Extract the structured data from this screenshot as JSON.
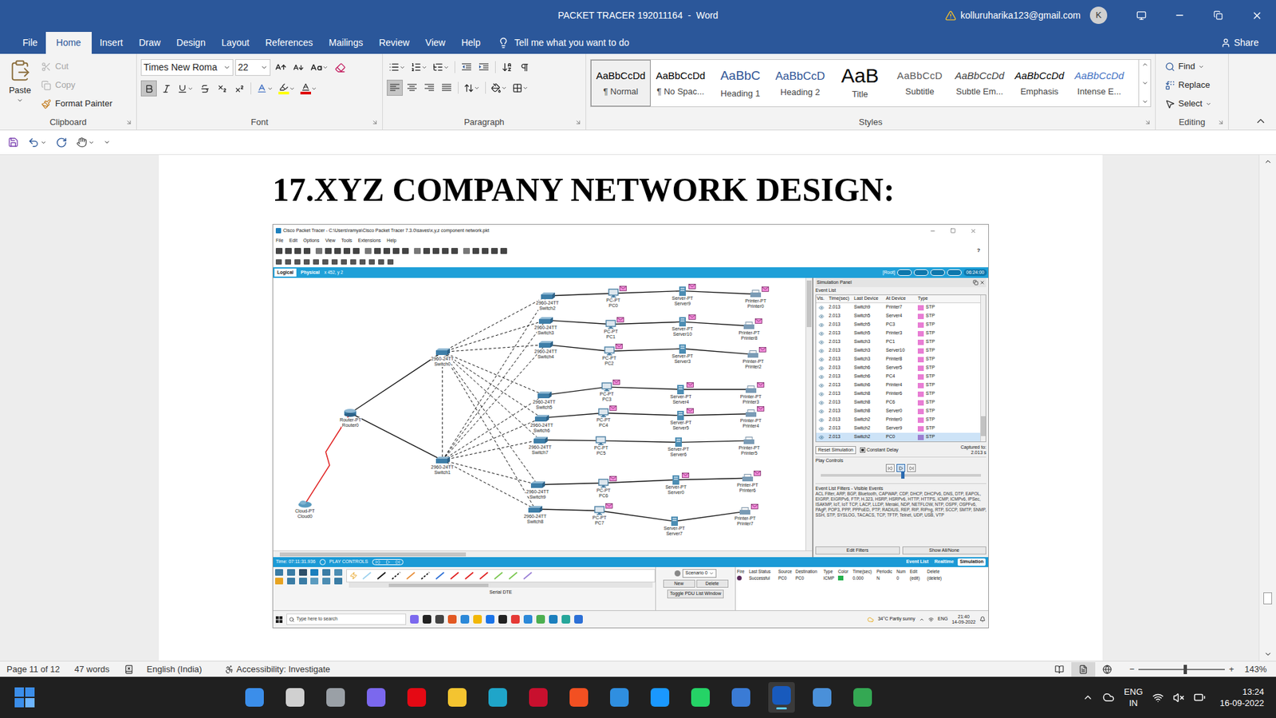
{
  "word": {
    "title": "PACKET TRACER 192011164  -  Word",
    "account": "kolluruharika123@gmail.com",
    "avatar": "K",
    "tabs": [
      {
        "label": "File",
        "selected": false
      },
      {
        "label": "Home",
        "selected": true
      },
      {
        "label": "Insert",
        "selected": false
      },
      {
        "label": "Draw",
        "selected": false
      },
      {
        "label": "Design",
        "selected": false
      },
      {
        "label": "Layout",
        "selected": false
      },
      {
        "label": "References",
        "selected": false
      },
      {
        "label": "Mailings",
        "selected": false
      },
      {
        "label": "Review",
        "selected": false
      },
      {
        "label": "View",
        "selected": false
      },
      {
        "label": "Help",
        "selected": false
      }
    ],
    "tell_me": "Tell me what you want to do",
    "share": "Share",
    "clipboard": {
      "label": "Clipboard",
      "paste": "Paste",
      "items": [
        {
          "label": "Cut",
          "disabled": true
        },
        {
          "label": "Copy",
          "disabled": true
        },
        {
          "label": "Format Painter",
          "disabled": false
        }
      ]
    },
    "font": {
      "label": "Font",
      "name": "Times New Roma",
      "size": "22",
      "font_color": "#e00000",
      "highlight_color": "#ffff00",
      "format": {
        "bold": true,
        "italic": false,
        "underline": false,
        "strikethrough": false,
        "subscript": false,
        "superscript": false
      }
    },
    "paragraph": {
      "label": "Paragraph",
      "align_left": true,
      "align_center": false,
      "align_right": false,
      "justify": false
    },
    "styles": {
      "label": "Styles",
      "items": [
        {
          "sample": "AaBbCcDd",
          "name": "¶ Normal",
          "selected": true,
          "kind": "normal"
        },
        {
          "sample": "AaBbCcDd",
          "name": "¶ No Spac...",
          "selected": false,
          "kind": "normal"
        },
        {
          "sample": "AaBbC",
          "name": "Heading 1",
          "selected": false,
          "kind": "heading1"
        },
        {
          "sample": "AaBbCcD",
          "name": "Heading 2",
          "selected": false,
          "kind": "heading2"
        },
        {
          "sample": "AaB",
          "name": "Title",
          "selected": false,
          "kind": "title"
        },
        {
          "sample": "AaBbCcD",
          "name": "Subtitle",
          "selected": false,
          "kind": "subtitle"
        },
        {
          "sample": "AaBbCcDd",
          "name": "Subtle Em...",
          "selected": false,
          "kind": "subtle"
        },
        {
          "sample": "AaBbCcDd",
          "name": "Emphasis",
          "selected": false,
          "kind": "emphasis"
        },
        {
          "sample": "AaBbCcDd",
          "name": "Intense E...",
          "selected": false,
          "kind": "intense"
        }
      ]
    },
    "editing": {
      "label": "Editing",
      "find": "Find",
      "replace": "Replace",
      "select": "Select"
    }
  },
  "document": {
    "heading": "17.XYZ COMPANY NETWORK DESIGN:",
    "scroll_level": 0.88,
    "pt": {
      "title": "Cisco Packet Tracer - C:\\Users\\ramya\\Cisco Packet Tracer 7.3.0\\saves\\x,y,z component network.pkt",
      "menu": [
        "File",
        "Edit",
        "Options",
        "View",
        "Tools",
        "Extensions",
        "Help"
      ],
      "help": "?",
      "views": [
        {
          "label": "Logical",
          "selected": true
        },
        {
          "label": "Physical",
          "selected": false
        }
      ],
      "coords": "x 452, y 2",
      "root": "[Root]",
      "clock": "06:24:00",
      "nodes": [
        {
          "kind": "switch",
          "model": "2960-24TT",
          "name": "Switch0",
          "pdu": false
        },
        {
          "kind": "switch",
          "model": "2960-24TT",
          "name": "Switch1",
          "pdu": false
        },
        {
          "kind": "router",
          "model": "Router-PT",
          "name": "Router0",
          "pdu": false
        },
        {
          "kind": "cloud",
          "model": "Cloud-PT",
          "name": "Cloud0",
          "pdu": false
        },
        {
          "kind": "switch",
          "model": "2960-24TT",
          "name": "Switch2",
          "pdu": false
        },
        {
          "kind": "switch",
          "model": "2960-24TT",
          "name": "Switch3",
          "pdu": false
        },
        {
          "kind": "switch",
          "model": "2960-24TT",
          "name": "Switch4",
          "pdu": false
        },
        {
          "kind": "switch",
          "model": "2960-24TT",
          "name": "Switch5",
          "pdu": false
        },
        {
          "kind": "switch",
          "model": "2960-24TT",
          "name": "Switch6",
          "pdu": false
        },
        {
          "kind": "switch",
          "model": "2960-24TT",
          "name": "Switch7",
          "pdu": false
        },
        {
          "kind": "switch",
          "model": "2960-24TT",
          "name": "Switch9",
          "pdu": false
        },
        {
          "kind": "switch",
          "model": "2960-24TT",
          "name": "Switch8",
          "pdu": false
        },
        {
          "kind": "pc",
          "model": "PC-PT",
          "name": "PC0",
          "pdu": true
        },
        {
          "kind": "pc",
          "model": "PC-PT",
          "name": "PC1",
          "pdu": true
        },
        {
          "kind": "pc",
          "model": "PC-PT",
          "name": "PC2",
          "pdu": true
        },
        {
          "kind": "pc",
          "model": "PC-PT",
          "name": "PC3",
          "pdu": true
        },
        {
          "kind": "pc",
          "model": "PC-PT",
          "name": "PC4",
          "pdu": true
        },
        {
          "kind": "pc",
          "model": "PC-PT",
          "name": "PC5",
          "pdu": false
        },
        {
          "kind": "pc",
          "model": "PC-PT",
          "name": "PC6",
          "pdu": true
        },
        {
          "kind": "pc",
          "model": "PC-PT",
          "name": "PC7",
          "pdu": true
        },
        {
          "kind": "server",
          "model": "Server-PT",
          "name": "Server9",
          "pdu": true
        },
        {
          "kind": "server",
          "model": "Server-PT",
          "name": "Server10",
          "pdu": true
        },
        {
          "kind": "server",
          "model": "Server-PT",
          "name": "Server3",
          "pdu": false
        },
        {
          "kind": "server",
          "model": "Server-PT",
          "name": "Server4",
          "pdu": true
        },
        {
          "kind": "server",
          "model": "Server-PT",
          "name": "Server5",
          "pdu": true
        },
        {
          "kind": "server",
          "model": "Server-PT",
          "name": "Server6",
          "pdu": false
        },
        {
          "kind": "server",
          "model": "Server-PT",
          "name": "Server0",
          "pdu": true
        },
        {
          "kind": "server",
          "model": "Server-PT",
          "name": "Server7",
          "pdu": false
        },
        {
          "kind": "printer",
          "model": "Printer-PT",
          "name": "Printer0",
          "pdu": true
        },
        {
          "kind": "printer",
          "model": "Printer-PT",
          "name": "Printer8",
          "pdu": true
        },
        {
          "kind": "printer",
          "model": "Printer-PT",
          "name": "Printer2",
          "pdu": true
        },
        {
          "kind": "printer",
          "model": "Printer-PT",
          "name": "Printer3",
          "pdu": true
        },
        {
          "kind": "printer",
          "model": "Printer-PT",
          "name": "Printer4",
          "pdu": true
        },
        {
          "kind": "printer",
          "model": "Printer-PT",
          "name": "Printer5",
          "pdu": false
        },
        {
          "kind": "printer",
          "model": "Printer-PT",
          "name": "Printer6",
          "pdu": true
        },
        {
          "kind": "printer",
          "model": "Printer-PT",
          "name": "Printer7",
          "pdu": true
        }
      ],
      "links": [
        {
          "from": 3,
          "to": 2,
          "kind": "serial"
        },
        {
          "from": 2,
          "to": 0,
          "kind": "straight"
        },
        {
          "from": 2,
          "to": 1,
          "kind": "straight"
        },
        {
          "from": 0,
          "to": 1,
          "kind": "cross"
        },
        {
          "from": 0,
          "to": 4,
          "kind": "cross"
        },
        {
          "from": 0,
          "to": 5,
          "kind": "cross"
        },
        {
          "from": 0,
          "to": 6,
          "kind": "cross"
        },
        {
          "from": 0,
          "to": 7,
          "kind": "cross"
        },
        {
          "from": 0,
          "to": 8,
          "kind": "cross"
        },
        {
          "from": 0,
          "to": 9,
          "kind": "cross"
        },
        {
          "from": 0,
          "to": 10,
          "kind": "cross"
        },
        {
          "from": 0,
          "to": 11,
          "kind": "cross"
        },
        {
          "from": 1,
          "to": 4,
          "kind": "cross"
        },
        {
          "from": 1,
          "to": 5,
          "kind": "cross"
        },
        {
          "from": 1,
          "to": 6,
          "kind": "cross"
        },
        {
          "from": 1,
          "to": 7,
          "kind": "cross"
        },
        {
          "from": 1,
          "to": 8,
          "kind": "cross"
        },
        {
          "from": 1,
          "to": 9,
          "kind": "cross"
        },
        {
          "from": 1,
          "to": 10,
          "kind": "cross"
        },
        {
          "from": 1,
          "to": 11,
          "kind": "cross"
        },
        {
          "from": 4,
          "to": 12,
          "kind": "straight"
        },
        {
          "from": 12,
          "to": 20,
          "kind": "straight"
        },
        {
          "from": 20,
          "to": 28,
          "kind": "straight"
        },
        {
          "from": 5,
          "to": 13,
          "kind": "straight"
        },
        {
          "from": 13,
          "to": 21,
          "kind": "straight"
        },
        {
          "from": 21,
          "to": 29,
          "kind": "straight"
        },
        {
          "from": 6,
          "to": 14,
          "kind": "straight"
        },
        {
          "from": 14,
          "to": 22,
          "kind": "straight"
        },
        {
          "from": 22,
          "to": 30,
          "kind": "straight"
        },
        {
          "from": 7,
          "to": 15,
          "kind": "straight"
        },
        {
          "from": 15,
          "to": 23,
          "kind": "straight"
        },
        {
          "from": 23,
          "to": 31,
          "kind": "straight"
        },
        {
          "from": 8,
          "to": 16,
          "kind": "straight"
        },
        {
          "from": 16,
          "to": 24,
          "kind": "straight"
        },
        {
          "from": 24,
          "to": 32,
          "kind": "straight"
        },
        {
          "from": 9,
          "to": 17,
          "kind": "straight"
        },
        {
          "from": 17,
          "to": 25,
          "kind": "straight"
        },
        {
          "from": 25,
          "to": 33,
          "kind": "straight"
        },
        {
          "from": 10,
          "to": 18,
          "kind": "straight"
        },
        {
          "from": 18,
          "to": 26,
          "kind": "straight"
        },
        {
          "from": 26,
          "to": 34,
          "kind": "straight"
        },
        {
          "from": 11,
          "to": 19,
          "kind": "straight"
        },
        {
          "from": 19,
          "to": 27,
          "kind": "straight"
        },
        {
          "from": 27,
          "to": 35,
          "kind": "straight"
        }
      ],
      "sim": {
        "title": "Simulation Panel",
        "event_list": "Event List",
        "columns": [
          "Vis.",
          "Time(sec)",
          "Last Device",
          "At Device",
          "Type"
        ],
        "events": [
          {
            "time": "2.013",
            "last": "Switch9",
            "at": "Printer7",
            "type": "STP",
            "color": "#e87dd4",
            "selected": false
          },
          {
            "time": "2.013",
            "last": "Switch5",
            "at": "Server4",
            "type": "STP",
            "color": "#e87dd4",
            "selected": false
          },
          {
            "time": "2.013",
            "last": "Switch5",
            "at": "PC3",
            "type": "STP",
            "color": "#e87dd4",
            "selected": false
          },
          {
            "time": "2.013",
            "last": "Switch5",
            "at": "Printer3",
            "type": "STP",
            "color": "#e87dd4",
            "selected": false
          },
          {
            "time": "2.013",
            "last": "Switch3",
            "at": "PC1",
            "type": "STP",
            "color": "#e87dd4",
            "selected": false
          },
          {
            "time": "2.013",
            "last": "Switch3",
            "at": "Server10",
            "type": "STP",
            "color": "#e87dd4",
            "selected": false
          },
          {
            "time": "2.013",
            "last": "Switch3",
            "at": "Printer8",
            "type": "STP",
            "color": "#e87dd4",
            "selected": false
          },
          {
            "time": "2.013",
            "last": "Switch6",
            "at": "Server5",
            "type": "STP",
            "color": "#e87dd4",
            "selected": false
          },
          {
            "time": "2.013",
            "last": "Switch6",
            "at": "PC4",
            "type": "STP",
            "color": "#e87dd4",
            "selected": false
          },
          {
            "time": "2.013",
            "last": "Switch6",
            "at": "Printer4",
            "type": "STP",
            "color": "#e87dd4",
            "selected": false
          },
          {
            "time": "2.013",
            "last": "Switch8",
            "at": "Printer6",
            "type": "STP",
            "color": "#e87dd4",
            "selected": false
          },
          {
            "time": "2.013",
            "last": "Switch8",
            "at": "PC6",
            "type": "STP",
            "color": "#e87dd4",
            "selected": false
          },
          {
            "time": "2.013",
            "last": "Switch8",
            "at": "Server0",
            "type": "STP",
            "color": "#e87dd4",
            "selected": false
          },
          {
            "time": "2.013",
            "last": "Switch2",
            "at": "Printer0",
            "type": "STP",
            "color": "#e87dd4",
            "selected": false
          },
          {
            "time": "2.013",
            "last": "Switch2",
            "at": "Server9",
            "type": "STP",
            "color": "#e87dd4",
            "selected": false
          },
          {
            "time": "2.013",
            "last": "Switch2",
            "at": "PC0",
            "type": "STP",
            "color": "#9b7fd1",
            "selected": true
          }
        ],
        "reset": "Reset Simulation",
        "constant_delay": {
          "label": "Constant Delay",
          "checked": true
        },
        "captured_label": "Captured to:",
        "captured_value": "2.013 s",
        "play_controls": "Play Controls",
        "play_level": 0.5,
        "filters_title": "Event List Filters - Visible Events",
        "filters": "ACL Filter, ARP, BGP, Bluetooth, CAPWAP, CDP, DHCP, DHCPv6, DNS, DTP, EAPOL, EIGRP, EIGRPv6, FTP, H.323, HSRP, HSRPv6, HTTP, HTTPS, ICMP, ICMPv6, IPSec, ISAKMP, IoT, IoT TCP, LACP, LLDP, Meraki, NDP, NETFLOW, NTP, OSPF, OSPFv6, PAgP, POP3, PPP, PPPoED, PTP, RADIUS, REP, RIP, RIPng, RTP, SCCP, SMTP, SNMP, SSH, STP, SYSLOG, TACACS, TCP, TFTP, Telnet, UDP, USB, VTP",
        "edit_filters": "Edit Filters",
        "show_all": "Show All/None"
      },
      "time": "Time: 07:11:31.936",
      "play_label": "PLAY CONTROLS",
      "modes": [
        {
          "label": "Event List",
          "selected": false
        },
        {
          "label": "Realtime",
          "selected": false
        },
        {
          "label": "Simulation",
          "selected": true
        }
      ],
      "connection_label": "Serial DTE",
      "scenario": "Scenario 0",
      "scenario_buttons": [
        "New",
        "Delete"
      ],
      "toggle_pdu": "Toggle PDU List Window",
      "pdu_columns": [
        "Fire",
        "Last Status",
        "Source",
        "Destination",
        "Type",
        "Color",
        "Time(sec)",
        "Periodic",
        "Num",
        "Edit",
        "Delete"
      ],
      "pdu_rows": [
        {
          "status": "Successful",
          "source": "PC0",
          "destination": "PC0",
          "type": "ICMP",
          "color": "#22b14c",
          "time": "0.000",
          "periodic": "N",
          "num": "0",
          "edit": "(edit)",
          "delete": "(delete)"
        }
      ],
      "taskbar": {
        "search": "Type here to search",
        "weather": "34°C  Partly sunny",
        "lang": "ENG",
        "time": "21:40",
        "date": "14-09-2022"
      }
    }
  },
  "status_bar": {
    "page": "Page 11 of 12",
    "words": "47 words",
    "language": "English (India)",
    "accessibility": "Accessibility: Investigate",
    "views": [
      {
        "selected": false
      },
      {
        "selected": true
      },
      {
        "selected": false
      }
    ],
    "zoom_minus": "−",
    "zoom_plus": "+",
    "zoom_level": 0.52,
    "zoom": "143%"
  },
  "taskbar": {
    "apps": [
      {
        "color": "#3b8eea",
        "active": false
      },
      {
        "color": "#d0d0d0",
        "active": false
      },
      {
        "color": "#9aa0a6",
        "active": false
      },
      {
        "color": "#7b68ee",
        "active": false
      },
      {
        "color": "#e50914",
        "active": false
      },
      {
        "color": "#f4c430",
        "active": false
      },
      {
        "color": "#1fa5c9",
        "active": false
      },
      {
        "color": "#c8102e",
        "active": false
      },
      {
        "color": "#f25022",
        "active": false
      },
      {
        "color": "#2f8fe0",
        "active": false
      },
      {
        "color": "#1a98ff",
        "active": false
      },
      {
        "color": "#25d366",
        "active": false
      },
      {
        "color": "#3a7bd5",
        "active": false
      },
      {
        "color": "#185abd",
        "active": true
      },
      {
        "color": "#4a90d9",
        "active": false
      },
      {
        "color": "#34a853",
        "active": false
      }
    ],
    "lang": "ENG",
    "region": "IN",
    "time": "13:24",
    "date": "16-09-2022"
  }
}
